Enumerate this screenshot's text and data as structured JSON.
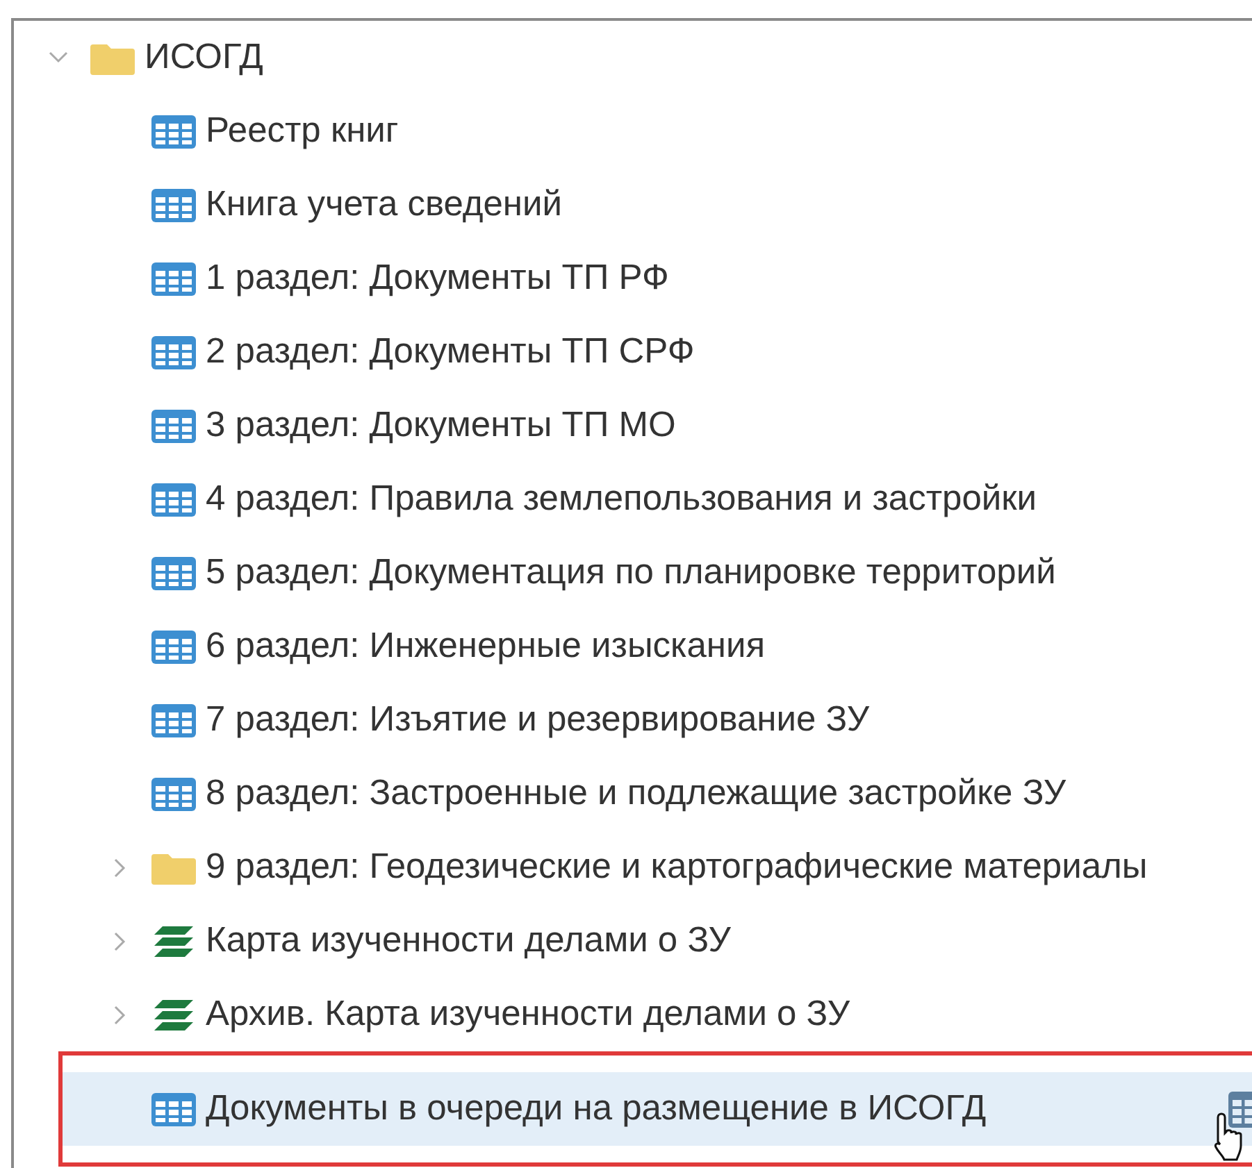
{
  "tree": [
    {
      "label": "ИСОГД",
      "kind": "folder",
      "expanded": true,
      "selected": false,
      "children": [
        {
          "label": "Реестр книг",
          "kind": "table",
          "selected": false
        },
        {
          "label": "Книга учета сведений",
          "kind": "table",
          "selected": false
        },
        {
          "label": "1 раздел: Документы ТП РФ",
          "kind": "table",
          "selected": false
        },
        {
          "label": "2 раздел: Документы ТП СРФ",
          "kind": "table",
          "selected": false
        },
        {
          "label": "3 раздел: Документы ТП МО",
          "kind": "table",
          "selected": false
        },
        {
          "label": "4 раздел: Правила землепользования и застройки",
          "kind": "table",
          "selected": false
        },
        {
          "label": "5 раздел: Документация по планировке территорий",
          "kind": "table",
          "selected": false
        },
        {
          "label": "6 раздел: Инженерные изыскания",
          "kind": "table",
          "selected": false
        },
        {
          "label": "7 раздел: Изъятие и резервирование ЗУ",
          "kind": "table",
          "selected": false
        },
        {
          "label": "8 раздел: Застроенные и подлежащие застройке ЗУ",
          "kind": "table",
          "selected": false
        },
        {
          "label": "9 раздел: Геодезические и картографические материалы",
          "kind": "folder",
          "expanded": false,
          "selected": false
        },
        {
          "label": "Карта изученности делами о ЗУ",
          "kind": "layers",
          "expanded": false,
          "selected": false
        },
        {
          "label": "Архив. Карта изученности делами о ЗУ",
          "kind": "layers",
          "expanded": false,
          "selected": false
        },
        {
          "label": "Документы в очереди на размещение в ИСОГД",
          "kind": "table",
          "selected": true,
          "highlighted": true
        }
      ]
    }
  ]
}
